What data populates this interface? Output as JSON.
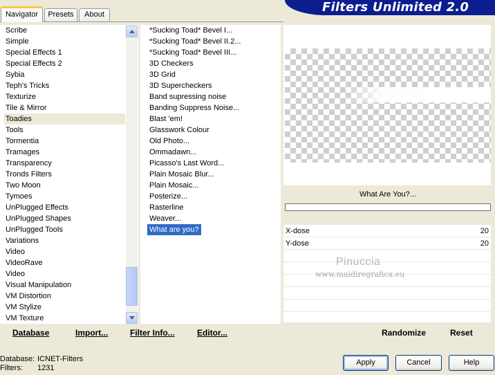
{
  "app": {
    "title": "Filters Unlimited 2.0"
  },
  "tabs": [
    {
      "label": "Navigator",
      "active": true
    },
    {
      "label": "Presets",
      "active": false
    },
    {
      "label": "About",
      "active": false
    }
  ],
  "categories": {
    "items": [
      "Scribe",
      "Simple",
      "Special Effects 1",
      "Special Effects 2",
      "Sybia",
      "Teph's Tricks",
      "Texturize",
      "Tile & Mirror",
      "Toadies",
      "Tools",
      "Tormentia",
      "Tramages",
      "Transparency",
      "Tronds Filters",
      "Two Moon",
      "Tymoes",
      "UnPlugged Effects",
      "UnPlugged Shapes",
      "UnPlugged Tools",
      "Variations",
      "Video",
      "VideoRave",
      "Video",
      "Visual Manipulation",
      "VM Distortion",
      "VM Stylize",
      "VM Texture"
    ],
    "selected": "Toadies"
  },
  "filters": {
    "items": [
      "*Sucking Toad*  Bevel I...",
      "*Sucking Toad*  Bevel II.2...",
      "*Sucking Toad*  Bevel III...",
      "3D Checkers",
      "3D Grid",
      "3D Supercheckers",
      "Band supressing noise",
      "Banding Suppress Noise...",
      "Blast 'em!",
      "Glasswork Colour",
      "Old Photo...",
      "Ommadawn...",
      "Picasso's Last Word...",
      "Plain Mosaic Blur...",
      "Plain Mosaic...",
      "Posterize...",
      "Rasterline",
      "Weaver...",
      "What are you?"
    ],
    "selected": "What are you?"
  },
  "preview": {
    "filter_name": "What Are You?..."
  },
  "params": [
    {
      "label": "X-dose",
      "value": "20"
    },
    {
      "label": "Y-dose",
      "value": "20"
    }
  ],
  "watermark": {
    "name": "Pinuccia",
    "url": "www.maidiregrafica.eu"
  },
  "actions": {
    "database": "Database",
    "import": "Import...",
    "filter_info": "Filter Info...",
    "editor": "Editor...",
    "randomize": "Randomize",
    "reset": "Reset"
  },
  "footer": {
    "database_label": "Database:",
    "database_value": "ICNET-Filters",
    "filters_label": "Filters:",
    "filters_value": "1231"
  },
  "buttons": {
    "apply": "Apply",
    "cancel": "Cancel",
    "help": "Help"
  },
  "colors": {
    "banner": "#0b1d8f",
    "selection": "#316ac5",
    "tab_accent": "#ffc83c"
  }
}
